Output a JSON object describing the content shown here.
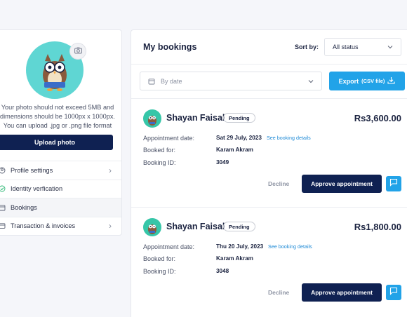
{
  "profile": {
    "photo_note": "Your photo should not exceed 5MB and dimensions should be 1000px x 1000px. You can upload .jpg or .png file format",
    "upload_label": "Upload photo",
    "menu": [
      {
        "label": "Profile settings",
        "icon": "profile-icon"
      },
      {
        "label": "Identity verfication",
        "icon": "check-icon"
      },
      {
        "label": "Bookings",
        "icon": "calendar-icon"
      },
      {
        "label": "Transaction & invoices",
        "icon": "invoice-icon"
      }
    ]
  },
  "bookings": {
    "title": "My bookings",
    "sort_label": "Sort by:",
    "sort_value": "All status",
    "date_filter_placeholder": "By date",
    "export_label": "Export",
    "export_sub": "(CSV file)",
    "field_labels": {
      "appointment_date": "Appointment date:",
      "booked_for": "Booked for:",
      "booking_id": "Booking ID:"
    },
    "details_link": "See booking details",
    "decline_label": "Decline",
    "approve_label": "Approve appointment",
    "items": [
      {
        "name": "Shayan Faisal",
        "status": "Pending",
        "amount": "Rs3,600.00",
        "date": "Sat 29 July, 2023",
        "booked_for": "Karam Akram",
        "booking_id": "3049"
      },
      {
        "name": "Shayan Faisal",
        "status": "Pending",
        "amount": "Rs1,800.00",
        "date": "Thu 20 July, 2023",
        "booked_for": "Karam Akram",
        "booking_id": "3048"
      }
    ]
  },
  "colors": {
    "primary": "#0f2152",
    "accent": "#22a3e8",
    "avatar_bg": "#5fd6d3"
  }
}
